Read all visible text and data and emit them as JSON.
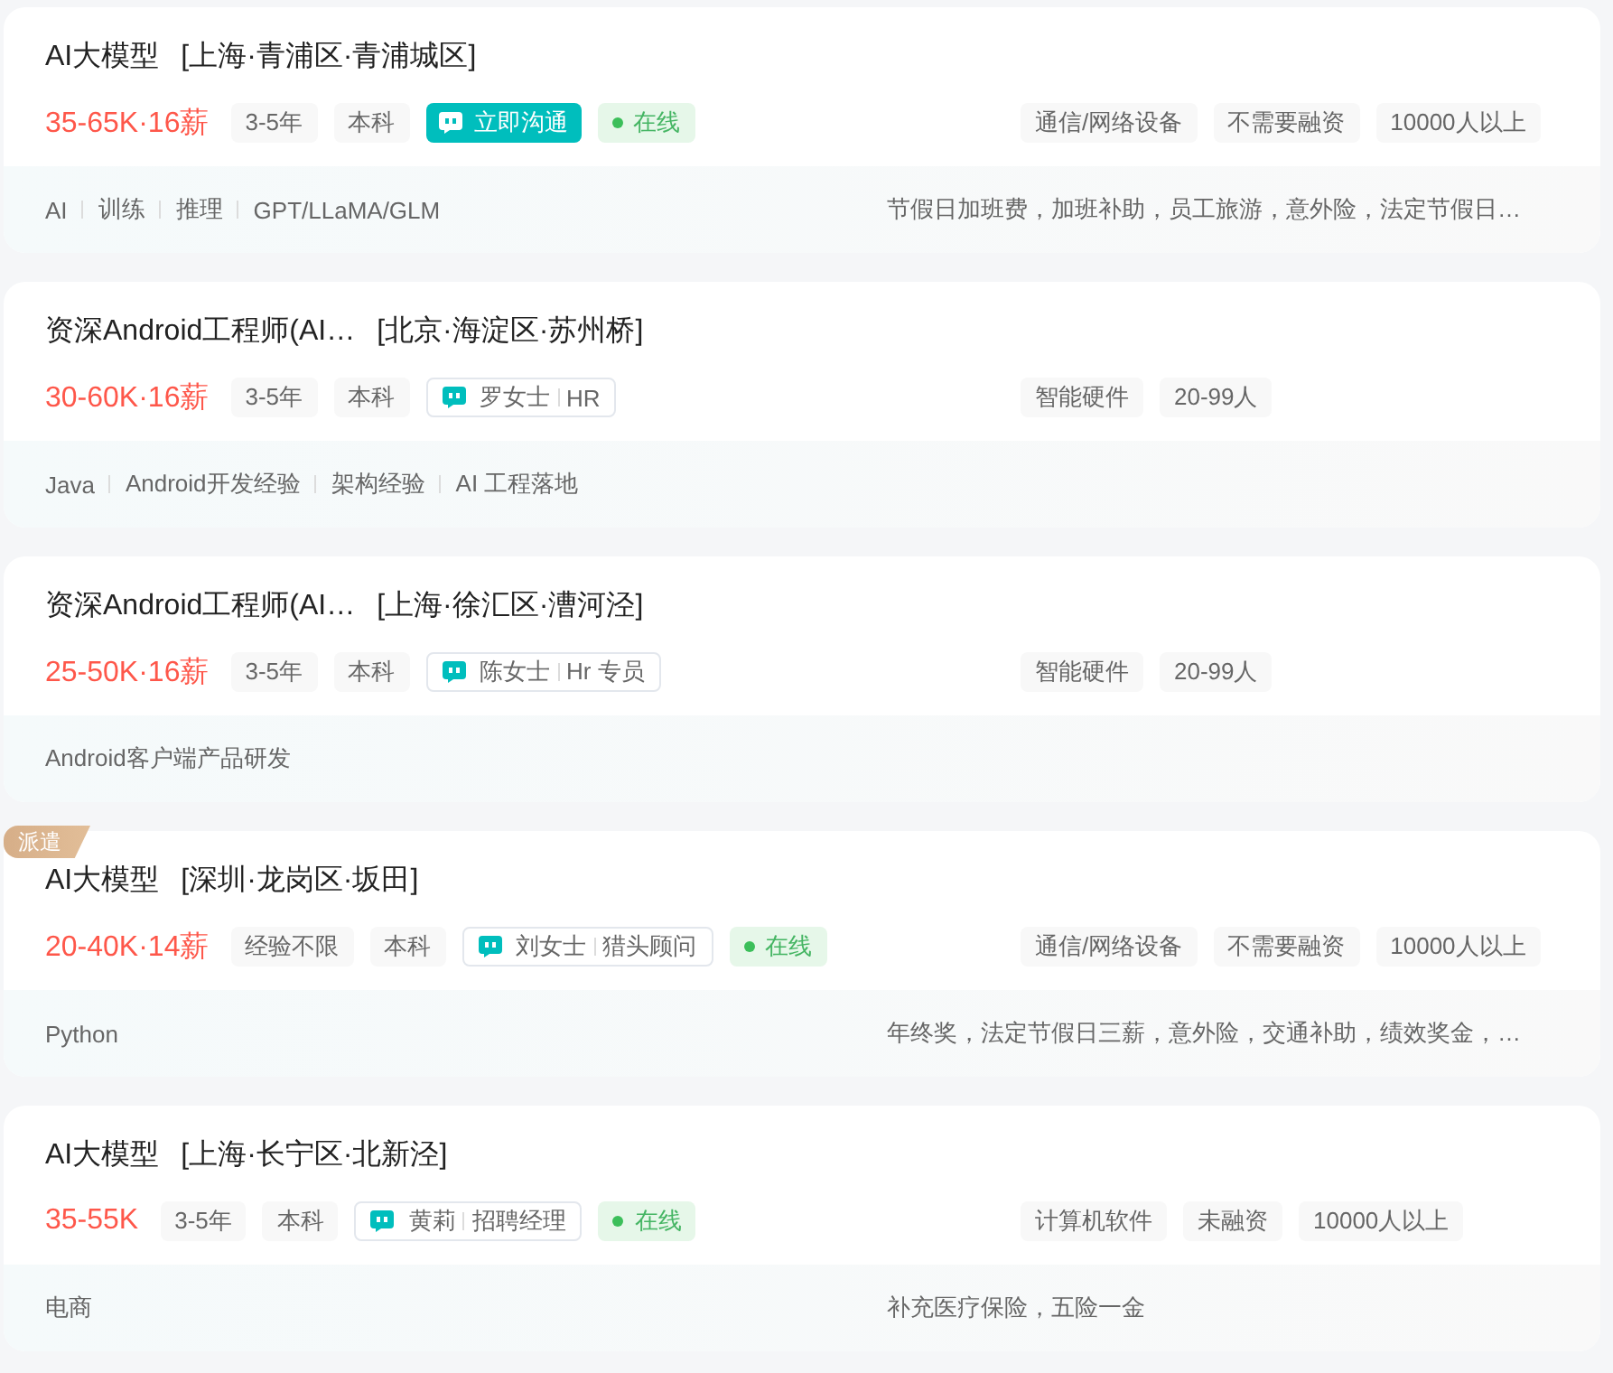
{
  "jobs": [
    {
      "title": "AI大模型",
      "location": "[上海·青浦区·青浦城区]",
      "salary": "35-65K·16薪",
      "requirements": [
        "3-5年",
        "本科"
      ],
      "contact": {
        "kind": "chat",
        "label": "立即沟通"
      },
      "online_status": "在线",
      "company_tags": [
        "通信/网络设备",
        "不需要融资",
        "10000人以上"
      ],
      "skills": [
        "AI",
        "训练",
        "推理",
        "GPT/LLaMA/GLM"
      ],
      "benefits": "节假日加班费，加班补助，员工旅游，意外险，法定节假日…"
    },
    {
      "title": "资深Android工程师(AI…",
      "location": "[北京·海淀区·苏州桥]",
      "salary": "30-60K·16薪",
      "requirements": [
        "3-5年",
        "本科"
      ],
      "contact": {
        "kind": "recruiter",
        "name": "罗女士",
        "role": "HR"
      },
      "company_tags": [
        "智能硬件",
        "20-99人"
      ],
      "skills": [
        "Java",
        "Android开发经验",
        "架构经验",
        "AI 工程落地"
      ]
    },
    {
      "title": "资深Android工程师(AI…",
      "location": "[上海·徐汇区·漕河泾]",
      "salary": "25-50K·16薪",
      "requirements": [
        "3-5年",
        "本科"
      ],
      "contact": {
        "kind": "recruiter",
        "name": "陈女士",
        "role": "Hr 专员"
      },
      "company_tags": [
        "智能硬件",
        "20-99人"
      ],
      "skills": [
        "Android客户端产品研发"
      ]
    },
    {
      "badge": "派遣",
      "title": "AI大模型",
      "location": "[深圳·龙岗区·坂田]",
      "salary": "20-40K·14薪",
      "requirements": [
        "经验不限",
        "本科"
      ],
      "contact": {
        "kind": "recruiter",
        "name": "刘女士",
        "role": "猎头顾问"
      },
      "online_status": "在线",
      "company_tags": [
        "通信/网络设备",
        "不需要融资",
        "10000人以上"
      ],
      "skills": [
        "Python"
      ],
      "benefits": "年终奖，法定节假日三薪，意外险，交通补助，绩效奖金，…"
    },
    {
      "title": "AI大模型",
      "location": "[上海·长宁区·北新泾]",
      "salary": "35-55K",
      "requirements": [
        "3-5年",
        "本科"
      ],
      "contact": {
        "kind": "recruiter",
        "name": "黄莉",
        "role": "招聘经理"
      },
      "online_status": "在线",
      "company_tags": [
        "计算机软件",
        "未融资",
        "10000人以上"
      ],
      "skills": [
        "电商"
      ],
      "benefits": "补充医疗保险，五险一金"
    }
  ]
}
